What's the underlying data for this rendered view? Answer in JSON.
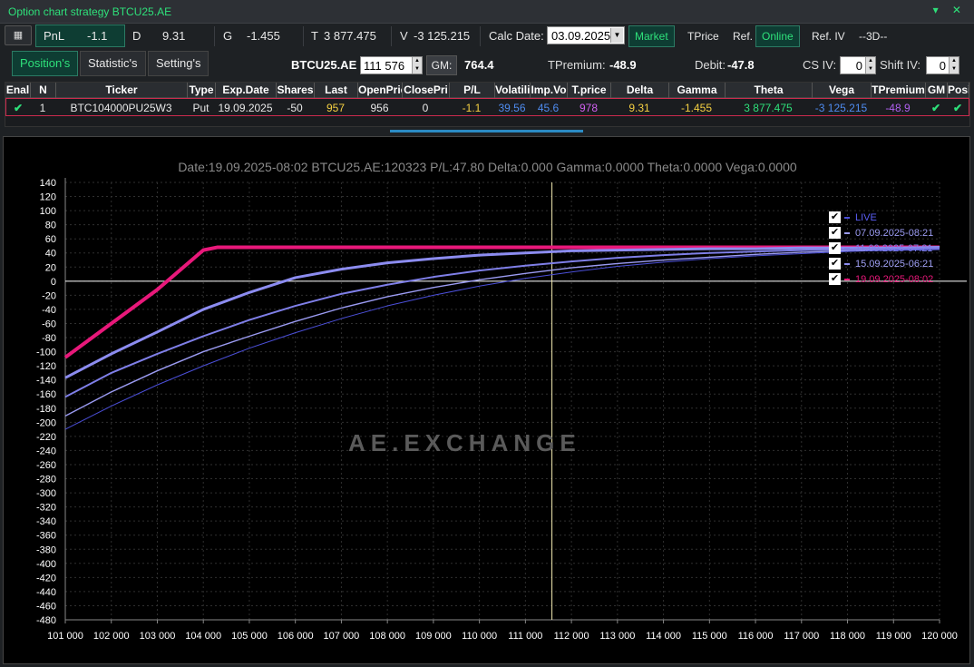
{
  "window": {
    "title": "Option chart strategy BTCU25.AE",
    "controls": "▾ ✕"
  },
  "toolbar": {
    "icon": "calculator-icon",
    "pnl_label": "PnL",
    "pnl_value": "-1.1",
    "d_label": "D",
    "d_value": "9.31",
    "g_label": "G",
    "g_value": "-1.455",
    "t_label": "T",
    "t_value": "3 877.475",
    "v_label": "V",
    "v_value": "-3 125.215",
    "calc_date_label": "Calc Date:",
    "calc_date_value": "03.09.2025",
    "market": "Market",
    "tprice": "TPrice",
    "ref": "Ref.",
    "online": "Online",
    "ref_iv": "Ref. IV",
    "threed": "--3D--"
  },
  "tabs": {
    "positions": "Position's",
    "statistics": "Statistic's",
    "settings": "Setting's"
  },
  "instrument": {
    "name": "BTCU25.AE",
    "price": "111 576",
    "gm_label": "GM:",
    "gm_value": "764.4",
    "tpremium_label": "TPremium:",
    "tpremium_value": "-48.9",
    "debit_label": "Debit:",
    "debit_value": "-47.8",
    "cs_iv_label": "CS IV:",
    "cs_iv_value": "0",
    "shift_iv_label": "Shift IV:",
    "shift_iv_value": "0"
  },
  "table": {
    "headers": [
      "Enal",
      "N",
      "Ticker",
      "Type",
      "Exp.Date",
      "Shares",
      "Last",
      "OpenPric",
      "ClosePri",
      "P/L",
      "Volatility",
      "Imp.Vo",
      "T.price",
      "Delta",
      "Gamma",
      "Theta",
      "Vega",
      "TPremium",
      "GM",
      "Posi"
    ],
    "row": [
      "✔",
      "1",
      "BTC104000PU25W3",
      "Put",
      "19.09.2025",
      "-50",
      "957",
      "956",
      "0",
      "-1.1",
      "39.56",
      "45.6",
      "978",
      "9.31",
      "-1.455",
      "3 877.475",
      "-3 125.215",
      "-48.9",
      "✔",
      "✔"
    ]
  },
  "chart": {
    "info": "Date:19.09.2025-08:02  BTCU25.AE:120323  P/L:47.80  Delta:0.000  Gamma:0.0000  Theta:0.0000  Vega:0.0000",
    "watermark": "AE.EXCHANGE",
    "legend": [
      "LIVE",
      "07.09.2025-08:21",
      "11.09.2025-07:21",
      "15.09.2025-06:21",
      "19.09.2025-08:02"
    ]
  },
  "chart_data": {
    "type": "line",
    "xlim": [
      101000,
      120000
    ],
    "ylim": [
      -480,
      140
    ],
    "x_ticks": [
      "101 000",
      "102 000",
      "103 000",
      "104 000",
      "105 000",
      "106 000",
      "107 000",
      "108 000",
      "109 000",
      "110 000",
      "111 000",
      "112 000",
      "113 000",
      "114 000",
      "115 000",
      "116 000",
      "117 000",
      "118 000",
      "119 000",
      "120 000"
    ],
    "y_ticks": [
      140,
      120,
      100,
      80,
      60,
      40,
      20,
      0,
      -20,
      -40,
      -60,
      -80,
      -100,
      -120,
      -140,
      -160,
      -180,
      -200,
      -220,
      -240,
      -260,
      -280,
      -300,
      -320,
      -340,
      -360,
      -380,
      -400,
      -420,
      -440,
      -460,
      -480
    ],
    "cursor_x": 111576,
    "colors": {
      "live": "#4b4fd8",
      "d07": "#9b9bf2",
      "d11": "#7f7fe8",
      "d15": "#8c8cf0",
      "d19": "#e8187a"
    },
    "series": [
      {
        "name": "19.09.2025-08:02",
        "x": [
          101000,
          103000,
          104000,
          104300,
          120000
        ],
        "y": [
          -108,
          -12,
          44,
          48,
          48
        ]
      },
      {
        "name": "15.09.2025-06:21",
        "x": [
          101000,
          102000,
          103000,
          104000,
          105000,
          106000,
          107000,
          108000,
          109000,
          110000,
          111000,
          112000,
          113000,
          114000,
          115000,
          116000,
          117000,
          118000,
          119000,
          120000
        ],
        "y": [
          -137,
          -103,
          -72,
          -40,
          -16,
          5,
          17,
          26,
          32,
          37,
          40,
          43,
          44,
          45,
          46,
          46,
          47,
          47,
          47,
          48
        ]
      },
      {
        "name": "11.09.2025-07:21",
        "x": [
          101000,
          102000,
          103000,
          104000,
          105000,
          106000,
          107000,
          108000,
          109000,
          110000,
          111000,
          112000,
          113000,
          114000,
          115000,
          116000,
          117000,
          118000,
          119000,
          120000
        ],
        "y": [
          -164,
          -130,
          -103,
          -78,
          -55,
          -35,
          -18,
          -5,
          6,
          15,
          22,
          28,
          33,
          37,
          40,
          42,
          44,
          45,
          46,
          47
        ]
      },
      {
        "name": "07.09.2025-08:21",
        "x": [
          101000,
          102000,
          103000,
          104000,
          105000,
          106000,
          107000,
          108000,
          109000,
          110000,
          111000,
          112000,
          113000,
          114000,
          115000,
          116000,
          117000,
          118000,
          119000,
          120000
        ],
        "y": [
          -191,
          -157,
          -127,
          -100,
          -78,
          -57,
          -38,
          -22,
          -9,
          2,
          11,
          19,
          25,
          30,
          34,
          38,
          41,
          43,
          44,
          45
        ]
      },
      {
        "name": "LIVE",
        "x": [
          101000,
          102000,
          103000,
          104000,
          105000,
          106000,
          107000,
          108000,
          109000,
          110000,
          111000,
          112000,
          113000,
          114000,
          115000,
          116000,
          117000,
          118000,
          119000,
          120000
        ],
        "y": [
          -210,
          -177,
          -147,
          -120,
          -95,
          -73,
          -53,
          -35,
          -20,
          -7,
          4,
          13,
          21,
          27,
          32,
          36,
          39,
          42,
          44,
          45
        ]
      }
    ]
  }
}
